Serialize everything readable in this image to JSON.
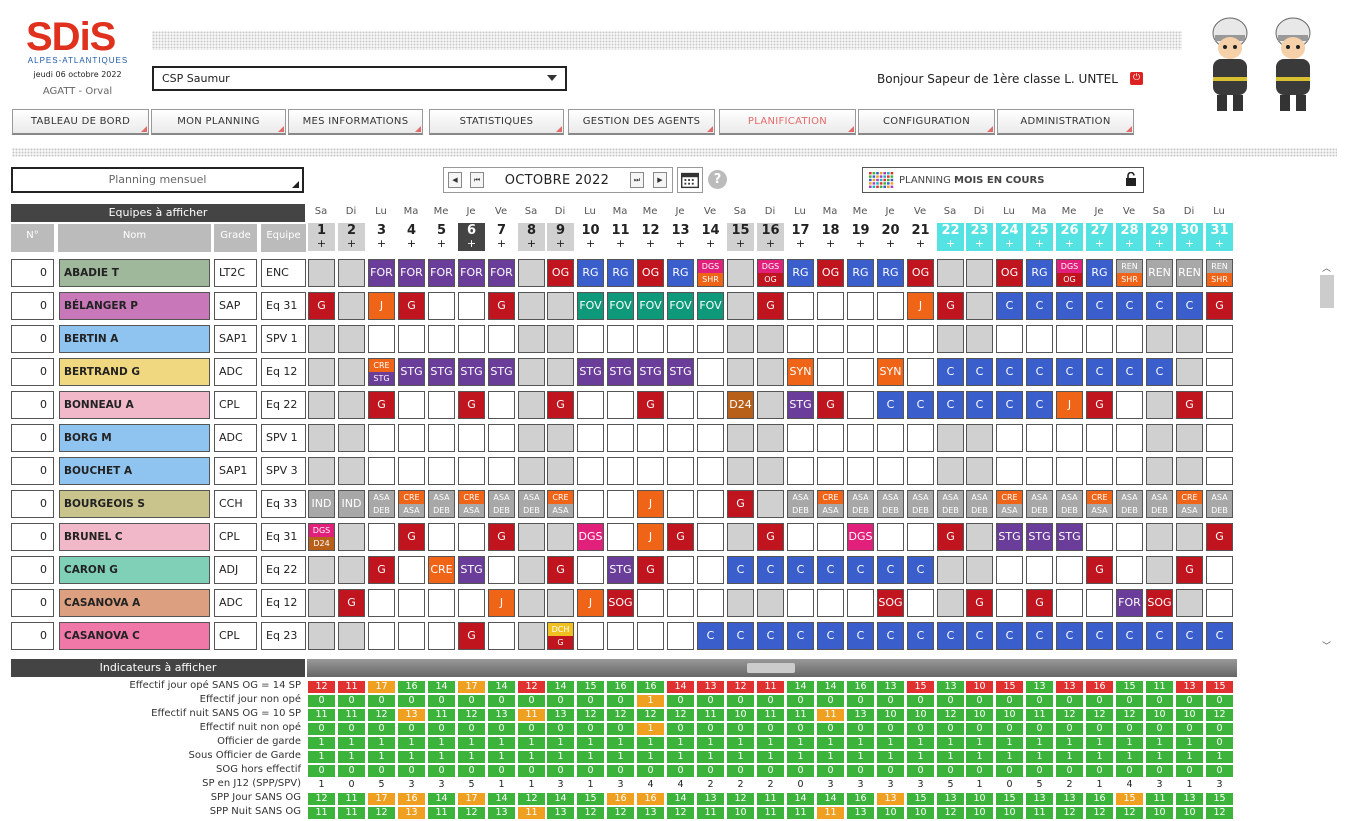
{
  "header": {
    "date": "jeudi 06 octobre 2022",
    "app": "AGATT - Orval",
    "logo_text": "SDiS",
    "logo_sub": "ALPES-ATLANTIQUES",
    "csp": "CSP Saumur",
    "greeting": "Bonjour Sapeur de 1ère classe L. UNTEL"
  },
  "nav": [
    "TABLEAU DE BORD",
    "MON PLANNING",
    "MES INFORMATIONS",
    "STATISTIQUES",
    "GESTION DES AGENTS",
    "PLANIFICATION",
    "CONFIGURATION",
    "ADMINISTRATION"
  ],
  "nav_active": "PLANIFICATION",
  "toolbar": {
    "mode": "Planning mensuel",
    "month": "OCTOBRE 2022",
    "planning_prefix": "PLANNING ",
    "planning_bold": "MOIS EN COURS",
    "help": "?",
    "prev2": "◀",
    "prev1": "⏮",
    "next1": "⏭",
    "next2": "▶"
  },
  "sections": {
    "equipes": "Equipes à afficher",
    "indicateurs": "Indicateurs à afficher"
  },
  "columns": {
    "num": "N°",
    "nom": "Nom",
    "grade": "Grade",
    "equipe": "Equipe"
  },
  "days": {
    "names": [
      "Sa",
      "Di",
      "Lu",
      "Ma",
      "Me",
      "Je",
      "Ve",
      "Sa",
      "Di",
      "Lu",
      "Ma",
      "Me",
      "Je",
      "Ve",
      "Sa",
      "Di",
      "Lu",
      "Ma",
      "Me",
      "Je",
      "Ve",
      "Sa",
      "Di",
      "Lu",
      "Ma",
      "Me",
      "Je",
      "Ve",
      "Sa",
      "Di",
      "Lu"
    ],
    "plus": "+",
    "weekend": [
      1,
      2,
      8,
      9,
      15,
      16,
      22,
      23,
      29,
      30
    ],
    "today": 6,
    "cyan": [
      22,
      23,
      24,
      25,
      26,
      27,
      28,
      29,
      30,
      31
    ]
  },
  "colors": {
    "red": "#c0141e",
    "blue": "#3a5fcd",
    "purple": "#6a3d9a",
    "orange": "#f06418",
    "teal": "#0e9a7a",
    "pink": "#e0207a",
    "grey": "#a8a8a8",
    "brown": "#b85f1a",
    "yellow": "#f0c020"
  },
  "agents": [
    {
      "count": "0",
      "name": "ABADIE T",
      "grade": "LT2C",
      "equipe": "ENC",
      "bg": "#9fb89b",
      "cells": {
        "3": "FOR",
        "4": "FOR",
        "5": "FOR",
        "6": "FOR",
        "7": "FOR",
        "9": "OG",
        "10": "RG",
        "11": "RG",
        "12": "OG",
        "13": "RG",
        "14": "DGS/SHR",
        "16": "DGS/OG",
        "17": "RG",
        "18": "OG",
        "19": "RG",
        "20": "RG",
        "21": "OG",
        "24": "OG",
        "25": "RG",
        "26": "DGS/OG",
        "27": "RG",
        "28": "REN/SHR",
        "29": "REN",
        "30": "REN",
        "31": "REN/SHR"
      }
    },
    {
      "count": "0",
      "name": "BÉLANGER P",
      "grade": "SAP",
      "equipe": "Eq 31",
      "bg": "#c878b8",
      "cells": {
        "1": "G",
        "3": "J",
        "4": "G",
        "7": "G",
        "10": "FOV",
        "11": "FOV",
        "12": "FOV",
        "13": "FOV",
        "14": "FOV",
        "16": "G",
        "21": "J",
        "22": "G",
        "24": "C",
        "25": "C",
        "26": "C",
        "27": "C",
        "28": "C",
        "29": "C",
        "30": "C",
        "31": "G"
      }
    },
    {
      "count": "0",
      "name": "BERTIN A",
      "grade": "SAP1",
      "equipe": "SPV 1",
      "bg": "#8fc4f0",
      "cells": {}
    },
    {
      "count": "0",
      "name": "BERTRAND G",
      "grade": "ADC",
      "equipe": "Eq 12",
      "bg": "#f0d880",
      "cells": {
        "3": "CRE/STG",
        "4": "STG",
        "5": "STG",
        "6": "STG",
        "7": "STG",
        "10": "STG",
        "11": "STG",
        "12": "STG",
        "13": "STG",
        "17": "SYN",
        "20": "SYN",
        "22": "C",
        "23": "C",
        "24": "C",
        "25": "C",
        "26": "C",
        "27": "C",
        "28": "C",
        "29": "C"
      }
    },
    {
      "count": "0",
      "name": "BONNEAU A",
      "grade": "CPL",
      "equipe": "Eq 22",
      "bg": "#f0b8c8",
      "cells": {
        "3": "G",
        "6": "G",
        "9": "G",
        "12": "G",
        "15": "D24",
        "17": "STG",
        "18": "G",
        "20": "C",
        "21": "C",
        "22": "C",
        "23": "C",
        "24": "C",
        "25": "C",
        "26": "J",
        "27": "G",
        "30": "G"
      }
    },
    {
      "count": "0",
      "name": "BORG M",
      "grade": "ADC",
      "equipe": "SPV 1",
      "bg": "#8fc4f0",
      "cells": {}
    },
    {
      "count": "0",
      "name": "BOUCHET A",
      "grade": "SAP1",
      "equipe": "SPV 3",
      "bg": "#8fc4f0",
      "cells": {}
    },
    {
      "count": "0",
      "name": "BOURGEOIS S",
      "grade": "CCH",
      "equipe": "Eq 33",
      "bg": "#c8c48c",
      "cells": {
        "1": "IND",
        "2": "IND",
        "3": "ASA/DEB",
        "4": "CRE/ASA",
        "5": "ASA/DEB",
        "6": "CRE/ASA",
        "7": "ASA/DEB",
        "8": "ASA/DEB",
        "9": "CRE/ASA",
        "12": "J",
        "15": "G",
        "17": "ASA/DEB",
        "18": "CRE/ASA",
        "19": "ASA/DEB",
        "20": "ASA/DEB",
        "21": "ASA/DEB",
        "22": "ASA/DEB",
        "23": "ASA/DEB",
        "24": "CRE/ASA",
        "25": "ASA/DEB",
        "26": "ASA/DEB",
        "27": "CRE/ASA",
        "28": "ASA/DEB",
        "29": "ASA/DEB",
        "30": "CRE/ASA",
        "31": "ASA/DEB"
      }
    },
    {
      "count": "0",
      "name": "BRUNEL C",
      "grade": "CPL",
      "equipe": "Eq 31",
      "bg": "#f0b8c8",
      "cells": {
        "1": "DGS/D24",
        "4": "G",
        "7": "G",
        "10": "DGS",
        "12": "J",
        "13": "G",
        "16": "G",
        "19": "DGS",
        "22": "G",
        "24": "STG",
        "25": "STG",
        "26": "STG",
        "31": "G"
      }
    },
    {
      "count": "0",
      "name": "CARON G",
      "grade": "ADJ",
      "equipe": "Eq 22",
      "bg": "#80d0b8",
      "cells": {
        "3": "G",
        "5": "CRE",
        "6": "STG",
        "9": "G",
        "11": "STG",
        "12": "G",
        "15": "C",
        "16": "C",
        "17": "C",
        "18": "C",
        "19": "C",
        "20": "C",
        "21": "C",
        "27": "G",
        "30": "G"
      }
    },
    {
      "count": "0",
      "name": "CASANOVA A",
      "grade": "ADC",
      "equipe": "Eq 12",
      "bg": "#dca080",
      "cells": {
        "2": "G",
        "7": "J",
        "10": "J",
        "11": "SOG",
        "20": "SOG",
        "23": "G",
        "25": "G",
        "28": "FOR",
        "29": "SOG"
      }
    },
    {
      "count": "0",
      "name": "CASANOVA C",
      "grade": "CPL",
      "equipe": "Eq 23",
      "bg": "#f078a8",
      "cells": {
        "6": "G",
        "9": "DCH/G",
        "14": "C",
        "15": "C",
        "16": "C",
        "17": "C",
        "18": "C",
        "19": "C",
        "20": "C",
        "21": "C",
        "22": "C",
        "23": "C",
        "24": "C",
        "25": "C",
        "26": "C",
        "27": "C",
        "28": "C",
        "29": "C",
        "30": "C",
        "31": "C"
      }
    }
  ],
  "indicators": [
    {
      "label": "Effectif jour opé SANS OG = 14 SP",
      "values": [
        12,
        11,
        17,
        16,
        14,
        17,
        14,
        12,
        14,
        15,
        16,
        16,
        14,
        13,
        12,
        11,
        14,
        14,
        16,
        13,
        15,
        13,
        10,
        15,
        13,
        13,
        16,
        15,
        11,
        13,
        15
      ],
      "colors": "rroggogrggggrrrrggggrgrrgrrggrrg"
    },
    {
      "label": "Effectif jour non opé",
      "values": [
        0,
        0,
        0,
        0,
        0,
        0,
        0,
        0,
        0,
        0,
        0,
        1,
        0,
        0,
        0,
        0,
        0,
        0,
        0,
        0,
        0,
        0,
        0,
        0,
        0,
        0,
        0,
        0,
        0,
        0,
        0
      ],
      "colors": "gggggggggggoggggggggggggggggggg"
    },
    {
      "label": "Effectif nuit SANS OG = 10 SP",
      "values": [
        11,
        11,
        12,
        13,
        11,
        12,
        13,
        11,
        13,
        12,
        12,
        12,
        12,
        11,
        10,
        11,
        11,
        11,
        13,
        10,
        10,
        12,
        10,
        10,
        11,
        12,
        12,
        12,
        10,
        10,
        12
      ],
      "colors": "gggogggogggggggggoggggggggggggg"
    },
    {
      "label": "Effectif nuit non opé",
      "values": [
        0,
        0,
        0,
        0,
        0,
        0,
        0,
        0,
        0,
        0,
        0,
        1,
        0,
        0,
        0,
        0,
        0,
        0,
        0,
        0,
        0,
        0,
        0,
        0,
        0,
        0,
        0,
        0,
        0,
        0,
        0
      ],
      "colors": "gggggggggggoggggggggggggggggggg"
    },
    {
      "label": "Officier de garde",
      "values": [
        1,
        1,
        1,
        1,
        1,
        1,
        1,
        1,
        1,
        1,
        1,
        1,
        1,
        1,
        1,
        1,
        1,
        1,
        1,
        1,
        1,
        1,
        1,
        1,
        1,
        1,
        1,
        1,
        1,
        1,
        0
      ],
      "colors": "gggggggggggggggggggggggggggggggr"
    },
    {
      "label": "Sous Officier de Garde",
      "values": [
        1,
        1,
        1,
        1,
        1,
        1,
        1,
        1,
        1,
        1,
        1,
        1,
        1,
        1,
        1,
        1,
        1,
        1,
        1,
        1,
        1,
        1,
        1,
        1,
        1,
        1,
        1,
        1,
        1,
        1,
        1
      ],
      "colors": "ggggggggggggggggggggggggggggggg"
    },
    {
      "label": "SOG hors effectif",
      "values": [
        0,
        0,
        0,
        0,
        0,
        0,
        0,
        0,
        0,
        0,
        0,
        0,
        0,
        0,
        0,
        0,
        0,
        0,
        0,
        0,
        0,
        0,
        0,
        0,
        0,
        0,
        0,
        0,
        0,
        0,
        0
      ],
      "colors": "ggggggggggggggggggggggggggggggg"
    },
    {
      "label": "SP en J12 (SPP/SPV)",
      "values": [
        1,
        0,
        5,
        3,
        3,
        5,
        1,
        1,
        3,
        1,
        3,
        4,
        4,
        2,
        2,
        2,
        0,
        3,
        3,
        3,
        3,
        5,
        1,
        0,
        5,
        2,
        1,
        4,
        3,
        1,
        3
      ],
      "colors": "ppppppppppppppppppppppppppppppp"
    },
    {
      "label": "SPP Jour SANS OG",
      "values": [
        12,
        11,
        17,
        16,
        14,
        17,
        14,
        12,
        14,
        15,
        16,
        16,
        14,
        13,
        12,
        11,
        14,
        14,
        16,
        13,
        15,
        13,
        10,
        15,
        13,
        13,
        16,
        15,
        11,
        13,
        15
      ],
      "colors": "ggoogoggggoogggggggogggggggoggg"
    },
    {
      "label": "SPP Nuit SANS OG",
      "values": [
        11,
        11,
        12,
        13,
        11,
        12,
        13,
        11,
        13,
        12,
        12,
        13,
        12,
        11,
        10,
        11,
        11,
        11,
        13,
        10,
        10,
        12,
        10,
        10,
        11,
        12,
        12,
        12,
        10,
        10,
        12
      ],
      "colors": "gggogggogggggggggoggggggggggggg"
    }
  ]
}
